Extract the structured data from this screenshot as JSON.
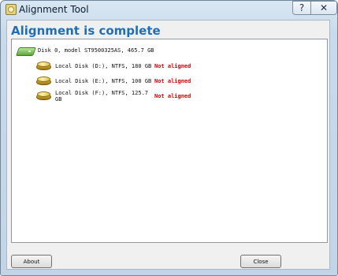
{
  "window": {
    "title": "Alignment Tool",
    "help_glyph": "?",
    "close_glyph": "✕"
  },
  "main": {
    "header": "Alignment is complete",
    "disk": {
      "label": "Disk 0, model ST9500325AS, 465.7 GB"
    },
    "partitions": [
      {
        "label": "Local Disk (D:), NTFS, 180 GB",
        "status": "Not aligned"
      },
      {
        "label": "Local Disk (E:), NTFS, 100 GB",
        "status": "Not aligned"
      },
      {
        "label": "Local Disk (F:), NTFS, 125.7 GB",
        "status": "Not aligned"
      }
    ]
  },
  "footer": {
    "about_label": "About",
    "close_label": "Close"
  },
  "colors": {
    "header": "#1f6fb6",
    "status_not_aligned": "#e00000"
  }
}
